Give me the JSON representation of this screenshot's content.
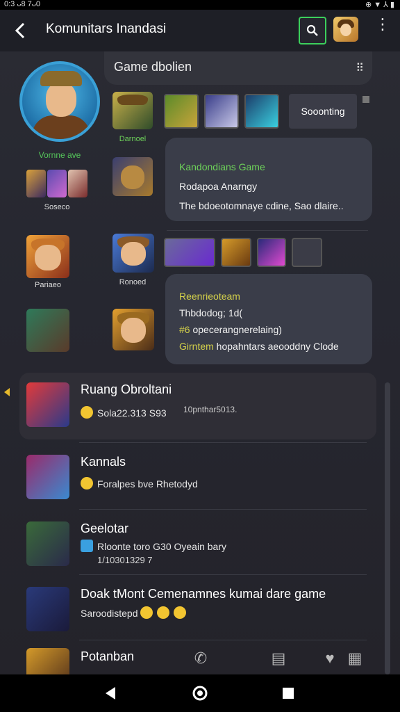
{
  "status": {
    "time": "0:3 ᴗ8 7ᴗ0",
    "right": "⊕ ▼ ⅄ ▮"
  },
  "appbar": {
    "title": "Komunitars Inandasi",
    "back_icon": "back-arrow-icon",
    "search_icon": "search-icon",
    "menu_icon": "more-vert-icon"
  },
  "profile": {
    "name": "Vornne ave",
    "small_label": "Soseco"
  },
  "tiles": {
    "t1_label": "Darnoel",
    "t2_label": "Pariaeo",
    "t3_label": "Ronoed"
  },
  "chat": {
    "title": "Game dbolien",
    "scroll_button": "Sooonting",
    "bubble1": {
      "line1": "Kandondians Game",
      "line2": "Rodapoa Anarngy",
      "line3": "The bdoeotomnaye cdine, Sao dlaire.."
    },
    "bubble2": {
      "line1": "Reenrieoteam",
      "line2": "Thbdodog; 1d(",
      "line3_prefix": "#6",
      "line3": " opecerangnerelaing)",
      "line4_prefix": "Girntem",
      "line4": " hopahntars aeooddny Clode"
    }
  },
  "list": [
    {
      "name": "Ruang Obroltani",
      "msg": "Sola22.313 S93",
      "meta": "10pnthar5013."
    },
    {
      "name": "Kannals",
      "msg": "Foralpes bve Rhetodyd"
    },
    {
      "name": "Geelotar",
      "msg": "Rloonte toro G30 Oyeain bary",
      "msg2": "1/10301329 7"
    },
    {
      "name": "Doak tMont Cemenamnes kumai dare game",
      "msg": "Saroodistepd"
    },
    {
      "name": "Potanban"
    }
  ],
  "colors": {
    "accent_green": "#3ccf5c",
    "accent_yellow": "#d4d14a",
    "bubble_bg": "#3a3d49"
  }
}
